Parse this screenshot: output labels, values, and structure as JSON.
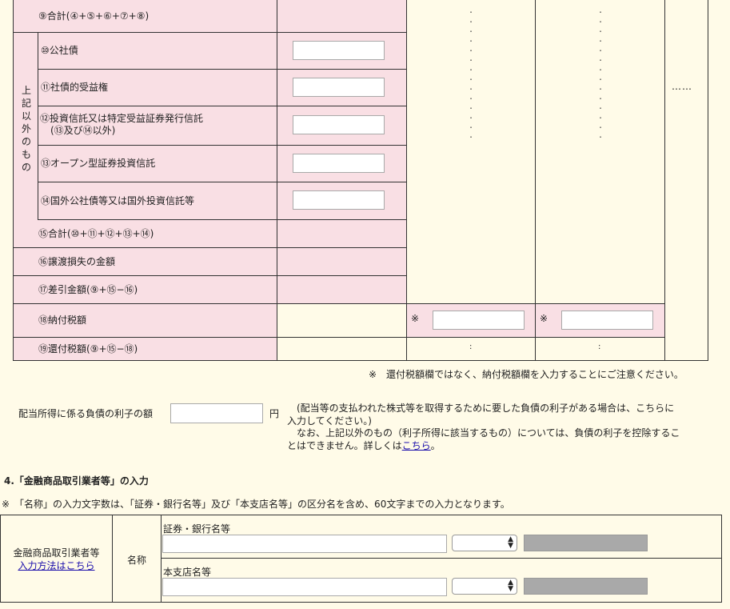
{
  "rows": {
    "r9": "⑨合計(④+⑤+⑥+⑦+⑧)",
    "r10": "⑩公社債",
    "r11": "⑪社債的受益権",
    "r12_line1": "⑫投資信託又は特定受益証券発行信託",
    "r12_line2": "(⑬及び⑭以外)",
    "r13": "⑬オープン型証券投資信託",
    "r14": "⑭国外公社債等又は国外投資信託等",
    "r15": "⑮合計(⑩+⑪+⑫+⑬+⑭)",
    "r16": "⑯譲渡損失の金額",
    "r17": "⑰差引金額(⑨+⑮−⑯)",
    "r18": "⑱納付税額",
    "r19": "⑲還付税額(⑨+⑮−⑱)"
  },
  "group_label": [
    "上",
    "記",
    "以",
    "外",
    "の",
    "も",
    "の"
  ],
  "ellipsis": "……",
  "kome": "※",
  "colon": ":",
  "note_refund": "※　還付税額欄ではなく、納付税額欄を入力することにご注意ください。",
  "interest": {
    "label": "配当所得に係る負債の利子の額",
    "unit": "円",
    "value": "",
    "desc_line1": "(配当等の支払われた株式等を取得するために要した負債の利子がある場合は、こちらに",
    "desc_line2": "入力してください。)",
    "desc_line3": "なお、上記以外のもの（利子所得に該当するもの）については、負債の利子を控除するこ",
    "desc_line4_prefix": "とはできません。詳しくは",
    "desc_link": "こちら",
    "desc_suffix": "。"
  },
  "section4": {
    "heading": "4.「金融商品取引業者等」の入力",
    "note": "※　「名称」の入力文字数は、「証券・銀行名等」及び「本支店名等」の区分名を含め、60文字までの入力となります。",
    "row_label": "金融商品取引業者等",
    "row_link": "入力方法はこちら",
    "name_label": "名称",
    "bank_label": "証券・銀行名等",
    "bank_value": "",
    "branch_label": "本支店名等",
    "branch_value": ""
  }
}
